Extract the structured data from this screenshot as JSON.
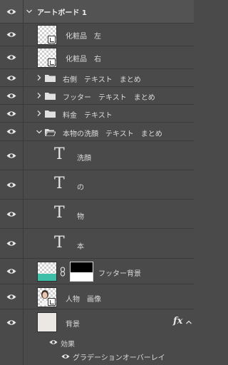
{
  "layers": {
    "artboard": {
      "label": "アートボード 1"
    },
    "cosmetics_left": {
      "label": "化粧品　左"
    },
    "cosmetics_right": {
      "label": "化粧品　右"
    },
    "right_text_group": {
      "label": "右側　テキスト　まとめ"
    },
    "footer_text_group": {
      "label": "フッター　テキスト　まとめ"
    },
    "price_text_group": {
      "label": "料金　テキスト"
    },
    "real_wash_group": {
      "label": "本物の洗顔　テキスト　まとめ"
    },
    "text_senganl": {
      "label": "洗顔",
      "glyph": "T"
    },
    "text_no": {
      "label": "の",
      "glyph": "T"
    },
    "text_mono": {
      "label": "物",
      "glyph": "T"
    },
    "text_hon": {
      "label": "本",
      "glyph": "T"
    },
    "footer_bg": {
      "label": "フッター背景"
    },
    "person_image": {
      "label": "人物　画像"
    },
    "background": {
      "label": "背景",
      "fx": "fx"
    },
    "effects": {
      "label": "効果"
    },
    "gradient_overlay": {
      "label": "グラデーションオーバーレイ"
    }
  },
  "colors": {
    "panel_bg": "#4a4a4a",
    "artboard_bg": "#535353",
    "footer_thumb_accent": "#3dbfa8",
    "background_thumb": "#ebe7e2"
  }
}
